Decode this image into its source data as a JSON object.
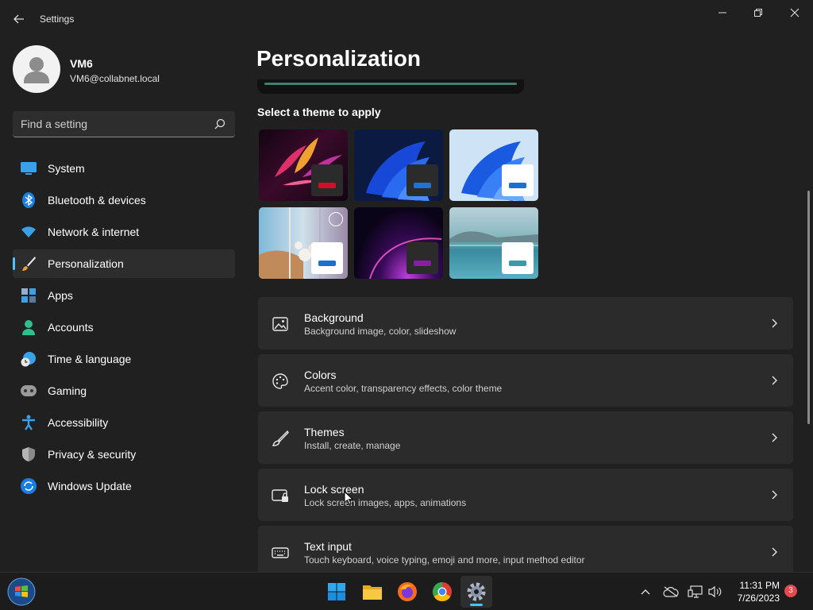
{
  "window": {
    "title": "Settings"
  },
  "profile": {
    "name": "VM6",
    "email": "VM6@collabnet.local"
  },
  "search": {
    "placeholder": "Find a setting"
  },
  "sidebar": {
    "items": [
      {
        "label": "System",
        "icon": "monitor-icon"
      },
      {
        "label": "Bluetooth & devices",
        "icon": "bluetooth-icon"
      },
      {
        "label": "Network & internet",
        "icon": "wifi-icon"
      },
      {
        "label": "Personalization",
        "icon": "brush-icon",
        "selected": true
      },
      {
        "label": "Apps",
        "icon": "apps-icon"
      },
      {
        "label": "Accounts",
        "icon": "person-icon"
      },
      {
        "label": "Time & language",
        "icon": "globe-clock-icon"
      },
      {
        "label": "Gaming",
        "icon": "gamepad-icon"
      },
      {
        "label": "Accessibility",
        "icon": "accessibility-icon"
      },
      {
        "label": "Privacy & security",
        "icon": "shield-icon"
      },
      {
        "label": "Windows Update",
        "icon": "update-icon"
      }
    ]
  },
  "main": {
    "title": "Personalization",
    "themes_heading": "Select a theme to apply",
    "themes": [
      {
        "name": "glow-theme",
        "swatch_bg": "#2b2b2b",
        "accent": "#d0102a"
      },
      {
        "name": "windows-dark-theme",
        "swatch_bg": "#2b2b2b",
        "accent": "#1b74d8"
      },
      {
        "name": "windows-light-theme",
        "swatch_bg": "#ffffff",
        "accent": "#1b6fd0"
      },
      {
        "name": "captured-motion-theme",
        "swatch_bg": "#ffffff",
        "accent": "#1b6fd0"
      },
      {
        "name": "sunrise-theme",
        "swatch_bg": "#2b2b2b",
        "accent": "#8a1ca8"
      },
      {
        "name": "flow-theme",
        "swatch_bg": "#ffffff",
        "accent": "#3a9aa8"
      }
    ],
    "cards": [
      {
        "title": "Background",
        "subtitle": "Background image, color, slideshow",
        "icon": "image-icon"
      },
      {
        "title": "Colors",
        "subtitle": "Accent color, transparency effects, color theme",
        "icon": "palette-icon"
      },
      {
        "title": "Themes",
        "subtitle": "Install, create, manage",
        "icon": "brush-icon"
      },
      {
        "title": "Lock screen",
        "subtitle": "Lock screen images, apps, animations",
        "icon": "lock-screen-icon"
      },
      {
        "title": "Text input",
        "subtitle": "Touch keyboard, voice typing, emoji and more, input method editor",
        "icon": "keyboard-icon"
      }
    ]
  },
  "taskbar": {
    "time": "11:31 PM",
    "date": "7/26/2023",
    "notifications": "3"
  },
  "colors": {
    "accent": "#4cc2ff",
    "background": "#202020",
    "card": "#2b2b2b"
  }
}
